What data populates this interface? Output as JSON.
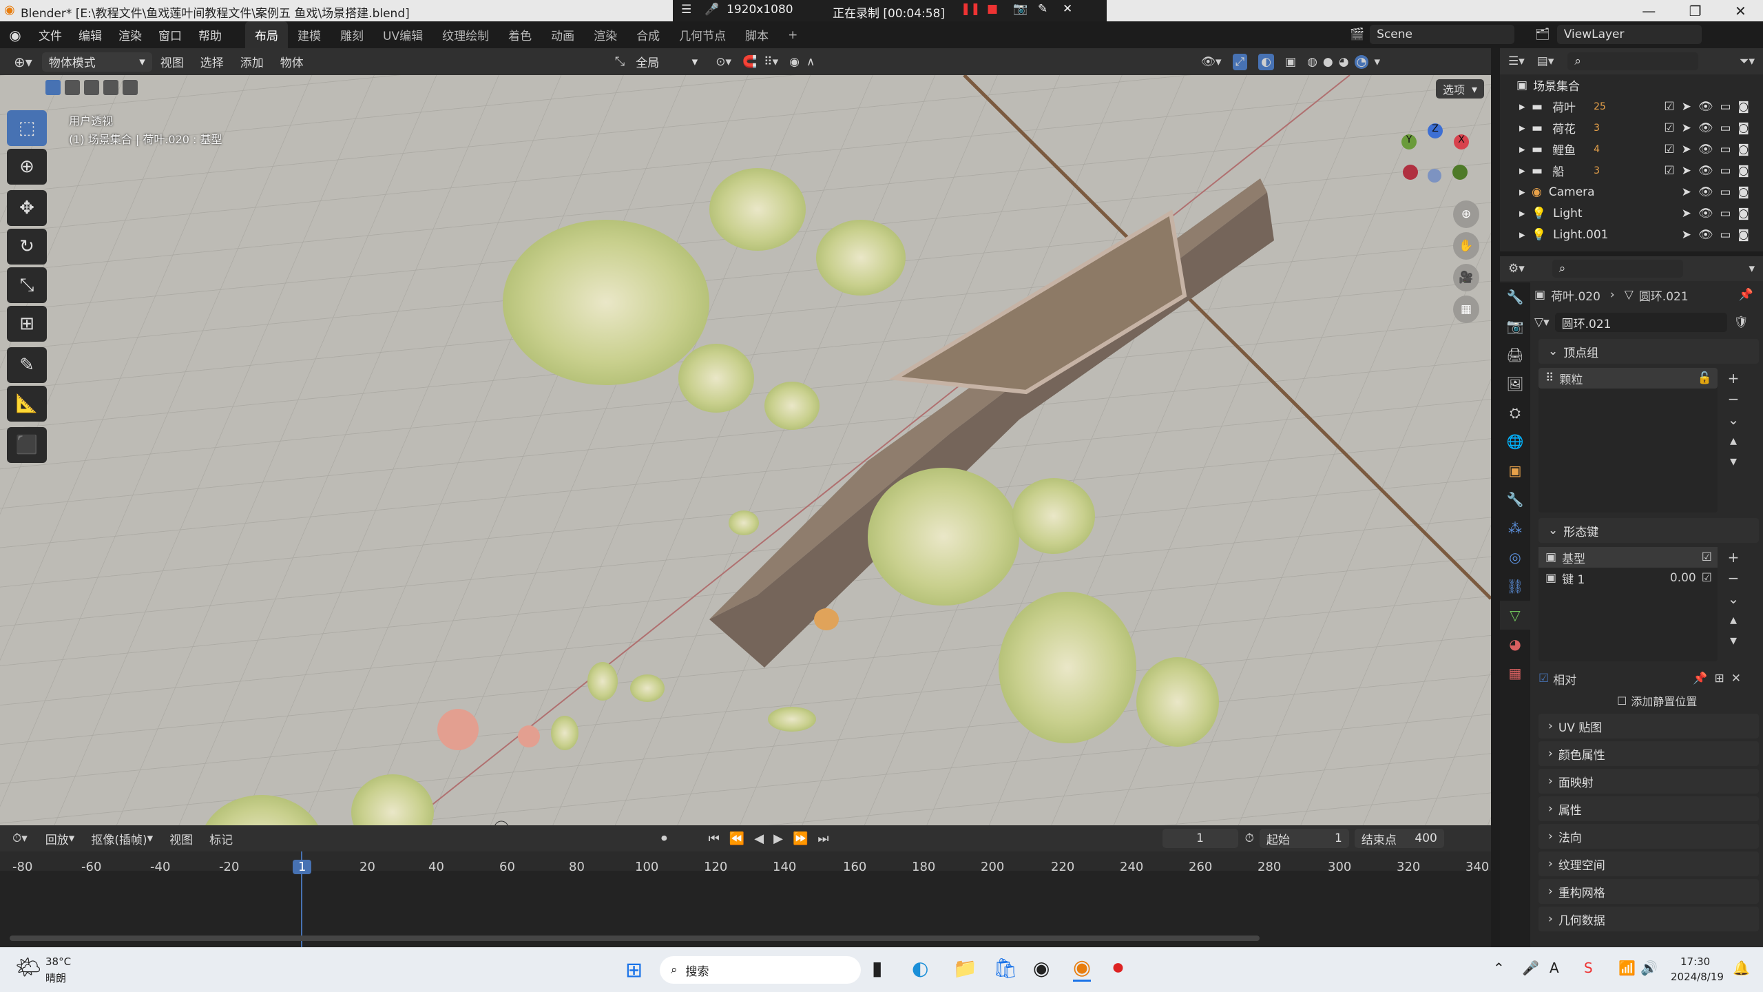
{
  "window": {
    "title": "Blender* [E:\\教程文件\\鱼戏莲叶间教程文件\\案例五 鱼戏\\场景搭建.blend]"
  },
  "recording": {
    "resolution": "1920x1080",
    "status": "正在录制 [00:04:58]"
  },
  "menu": {
    "items": [
      "文件",
      "编辑",
      "渲染",
      "窗口",
      "帮助"
    ],
    "workspaces": [
      "布局",
      "建模",
      "雕刻",
      "UV编辑",
      "纹理绘制",
      "着色",
      "动画",
      "渲染",
      "合成",
      "几何节点",
      "脚本"
    ],
    "scene": "Scene",
    "view_layer": "ViewLayer"
  },
  "viewport": {
    "mode": "物体模式",
    "menus": [
      "视图",
      "选择",
      "添加",
      "物体"
    ],
    "transform": "全局",
    "options": "选项",
    "overlay_title": "用户透视",
    "overlay_sub": "(1) 场景集合 | 荷叶.020 : 基型"
  },
  "outliner": {
    "root": "场景集合",
    "items": [
      {
        "name": "荷叶",
        "badge": "25",
        "type": "collection"
      },
      {
        "name": "荷花",
        "badge": "3",
        "type": "collection"
      },
      {
        "name": "鲤鱼",
        "badge": "4",
        "type": "collection"
      },
      {
        "name": "船",
        "badge": "3",
        "type": "collection"
      },
      {
        "name": "Camera",
        "type": "camera"
      },
      {
        "name": "Light",
        "type": "light"
      },
      {
        "name": "Light.001",
        "type": "light"
      }
    ]
  },
  "properties": {
    "breadcrumb_obj": "荷叶.020",
    "breadcrumb_mesh": "圆环.021",
    "mesh_name": "圆环.021",
    "vgroups_title": "顶点组",
    "vgroup_item": "颗粒",
    "shapekeys_title": "形态键",
    "shapekeys": [
      {
        "name": "基型",
        "value": ""
      },
      {
        "name": "键 1",
        "value": "0.00"
      }
    ],
    "relative_label": "相对",
    "add_rest_label": "添加静置位置",
    "collapsed": [
      "UV 贴图",
      "颜色属性",
      "面映射",
      "属性",
      "法向",
      "纹理空间",
      "重构网格",
      "几何数据"
    ]
  },
  "timeline": {
    "menus": [
      "回放",
      "抠像(插帧)",
      "视图",
      "标记"
    ],
    "current": "1",
    "start_label": "起始",
    "start": "1",
    "end_label": "结束点",
    "end": "400",
    "ticks": [
      "-80",
      "-60",
      "-40",
      "-20",
      "1",
      "20",
      "40",
      "60",
      "80",
      "100",
      "120",
      "140",
      "160",
      "180",
      "200",
      "220",
      "240",
      "260",
      "280",
      "300",
      "320",
      "340"
    ]
  },
  "taskbar": {
    "temp": "38°C",
    "weather": "晴朗",
    "search": "搜索",
    "time": "17:30",
    "date": "2024/8/19"
  }
}
